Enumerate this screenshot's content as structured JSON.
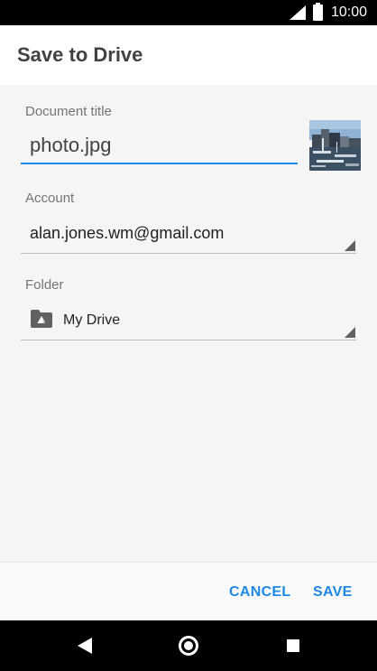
{
  "status_bar": {
    "time": "10:00",
    "icons": [
      "signal-icon",
      "battery-icon"
    ]
  },
  "dialog": {
    "title": "Save to Drive"
  },
  "document": {
    "label": "Document title",
    "value": "photo.jpg"
  },
  "account": {
    "label": "Account",
    "value": "alan.jones.wm@gmail.com"
  },
  "folder": {
    "label": "Folder",
    "value": "My Drive",
    "icon": "drive-folder-icon"
  },
  "buttons": {
    "cancel": "CANCEL",
    "save": "SAVE"
  },
  "nav_bar": {
    "icons": [
      "back-icon",
      "home-icon",
      "recent-apps-icon"
    ]
  },
  "colors": {
    "accent": "#1e88e5",
    "title_text": "#424242",
    "label_text": "#757575",
    "status_bar": "#000000"
  }
}
